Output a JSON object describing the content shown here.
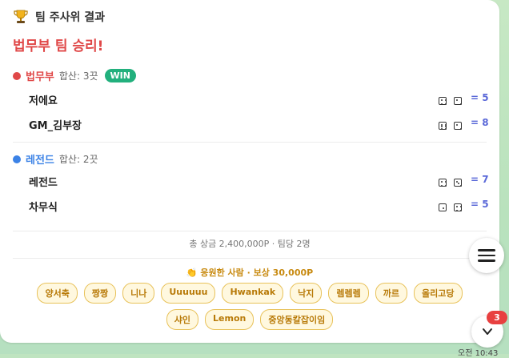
{
  "header": {
    "title": "팀 주사위 결과",
    "icon": "trophy-icon"
  },
  "winner_text": "법무부 팀 승리!",
  "teams": [
    {
      "name": "법무부",
      "color": "#e04848",
      "total": "합산: 3끗",
      "badge": "WIN",
      "players": [
        {
          "name": "저에요",
          "dice": [
            4,
            2
          ],
          "score": "= 5"
        },
        {
          "name": "GM_김부장",
          "dice": [
            6,
            2
          ],
          "score": "= 8"
        }
      ]
    },
    {
      "name": "레전드",
      "color": "#3b82e6",
      "total": "합산: 2끗",
      "badge": "",
      "players": [
        {
          "name": "레전드",
          "dice": [
            4,
            3
          ],
          "score": "= 7"
        },
        {
          "name": "차무식",
          "dice": [
            1,
            4
          ],
          "score": "= 5"
        }
      ]
    }
  ],
  "prize_text": "총 상금 2,400,000P · 팀당 2명",
  "cheer_text": "👏 응원한 사람 · 보상 30,000P",
  "supporters": [
    "양서축",
    "짱짱",
    "니나",
    "Uuuuuu",
    "Hwankak",
    "낙지",
    "렘렘렘",
    "까르",
    "올리고당",
    "샤인",
    "Lemon",
    "중앙동칼잡이임"
  ],
  "notification_count": "3",
  "timestamp": "오전 10:43"
}
